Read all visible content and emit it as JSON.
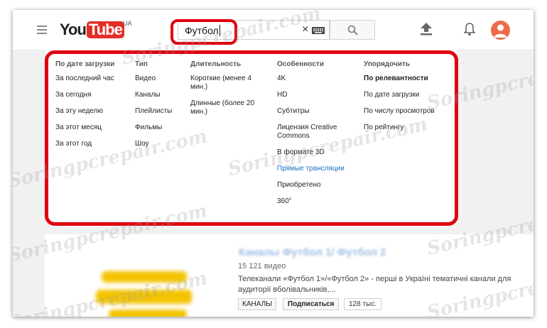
{
  "header": {
    "logo_text_you": "You",
    "logo_text_tube": "Tube",
    "country_code": "UA",
    "search_value": "Футбол",
    "clear_symbol": "×",
    "icons": [
      "menu-icon",
      "clear-icon",
      "keyboard-icon",
      "search-icon",
      "upload-icon",
      "bell-icon",
      "avatar-icon"
    ]
  },
  "filters": {
    "columns": [
      {
        "title": "По дате загрузки",
        "items": [
          "За последний час",
          "За сегодня",
          "За эту неделю",
          "За этот месяц",
          "За этот год"
        ]
      },
      {
        "title": "Тип",
        "items": [
          "Видео",
          "Каналы",
          "Плейлисты",
          "Фильмы",
          "Шоу"
        ]
      },
      {
        "title": "Длительность",
        "items": [
          "Короткие (менее 4 мин.)",
          "Длинные (более 20 мин.)"
        ]
      },
      {
        "title": "Особенности",
        "items": [
          "4K",
          "HD",
          "Субтитры",
          "Лицензия Creative Commons",
          "В формате 3D",
          "Прямые трансляции",
          "Приобретено",
          "360°"
        ]
      },
      {
        "title": "Упорядочить",
        "items": [
          "По релевантности",
          "По дате загрузки",
          "По числу просмотров",
          "По рейтингу"
        ]
      }
    ]
  },
  "result": {
    "title": "Каналы Футбол 1/ Футбол 2",
    "meta": "15 121 видео",
    "description_line1": "Телеканали «Футбол 1»/«Футбол 2» - перші в Україні тематичні канали для",
    "description_line2": "аудиторії вболівальників,...",
    "badge_label": "КАНАЛЫ",
    "subscribe_label": "Подписаться",
    "subscriber_count": "128 тыс."
  },
  "watermark": "Soringpcrepair.com",
  "colors": {
    "brand_red": "#e52d27",
    "highlight_red": "#e0000f",
    "link_blue": "#1a6fc4",
    "avatar": "#ef6b4a"
  }
}
